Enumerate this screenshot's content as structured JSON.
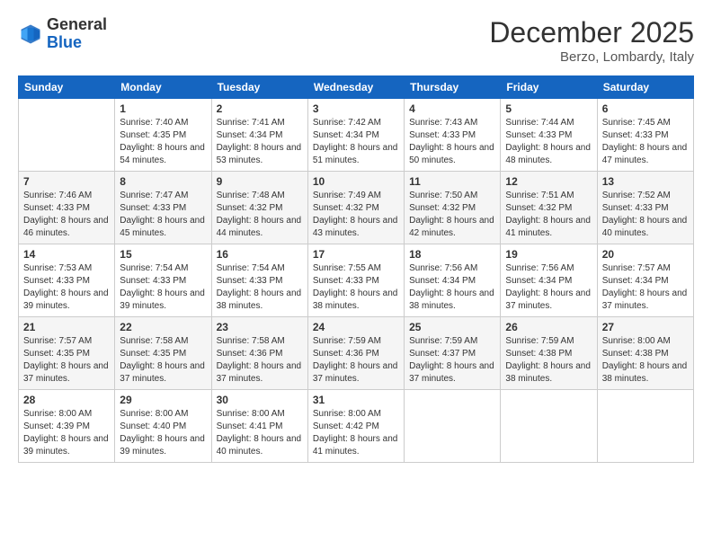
{
  "header": {
    "logo_general": "General",
    "logo_blue": "Blue",
    "month_title": "December 2025",
    "location": "Berzo, Lombardy, Italy"
  },
  "days_of_week": [
    "Sunday",
    "Monday",
    "Tuesday",
    "Wednesday",
    "Thursday",
    "Friday",
    "Saturday"
  ],
  "weeks": [
    [
      {
        "day": "",
        "sunrise": "",
        "sunset": "",
        "daylight": ""
      },
      {
        "day": "1",
        "sunrise": "Sunrise: 7:40 AM",
        "sunset": "Sunset: 4:35 PM",
        "daylight": "Daylight: 8 hours and 54 minutes."
      },
      {
        "day": "2",
        "sunrise": "Sunrise: 7:41 AM",
        "sunset": "Sunset: 4:34 PM",
        "daylight": "Daylight: 8 hours and 53 minutes."
      },
      {
        "day": "3",
        "sunrise": "Sunrise: 7:42 AM",
        "sunset": "Sunset: 4:34 PM",
        "daylight": "Daylight: 8 hours and 51 minutes."
      },
      {
        "day": "4",
        "sunrise": "Sunrise: 7:43 AM",
        "sunset": "Sunset: 4:33 PM",
        "daylight": "Daylight: 8 hours and 50 minutes."
      },
      {
        "day": "5",
        "sunrise": "Sunrise: 7:44 AM",
        "sunset": "Sunset: 4:33 PM",
        "daylight": "Daylight: 8 hours and 48 minutes."
      },
      {
        "day": "6",
        "sunrise": "Sunrise: 7:45 AM",
        "sunset": "Sunset: 4:33 PM",
        "daylight": "Daylight: 8 hours and 47 minutes."
      }
    ],
    [
      {
        "day": "7",
        "sunrise": "Sunrise: 7:46 AM",
        "sunset": "Sunset: 4:33 PM",
        "daylight": "Daylight: 8 hours and 46 minutes."
      },
      {
        "day": "8",
        "sunrise": "Sunrise: 7:47 AM",
        "sunset": "Sunset: 4:33 PM",
        "daylight": "Daylight: 8 hours and 45 minutes."
      },
      {
        "day": "9",
        "sunrise": "Sunrise: 7:48 AM",
        "sunset": "Sunset: 4:32 PM",
        "daylight": "Daylight: 8 hours and 44 minutes."
      },
      {
        "day": "10",
        "sunrise": "Sunrise: 7:49 AM",
        "sunset": "Sunset: 4:32 PM",
        "daylight": "Daylight: 8 hours and 43 minutes."
      },
      {
        "day": "11",
        "sunrise": "Sunrise: 7:50 AM",
        "sunset": "Sunset: 4:32 PM",
        "daylight": "Daylight: 8 hours and 42 minutes."
      },
      {
        "day": "12",
        "sunrise": "Sunrise: 7:51 AM",
        "sunset": "Sunset: 4:32 PM",
        "daylight": "Daylight: 8 hours and 41 minutes."
      },
      {
        "day": "13",
        "sunrise": "Sunrise: 7:52 AM",
        "sunset": "Sunset: 4:33 PM",
        "daylight": "Daylight: 8 hours and 40 minutes."
      }
    ],
    [
      {
        "day": "14",
        "sunrise": "Sunrise: 7:53 AM",
        "sunset": "Sunset: 4:33 PM",
        "daylight": "Daylight: 8 hours and 39 minutes."
      },
      {
        "day": "15",
        "sunrise": "Sunrise: 7:54 AM",
        "sunset": "Sunset: 4:33 PM",
        "daylight": "Daylight: 8 hours and 39 minutes."
      },
      {
        "day": "16",
        "sunrise": "Sunrise: 7:54 AM",
        "sunset": "Sunset: 4:33 PM",
        "daylight": "Daylight: 8 hours and 38 minutes."
      },
      {
        "day": "17",
        "sunrise": "Sunrise: 7:55 AM",
        "sunset": "Sunset: 4:33 PM",
        "daylight": "Daylight: 8 hours and 38 minutes."
      },
      {
        "day": "18",
        "sunrise": "Sunrise: 7:56 AM",
        "sunset": "Sunset: 4:34 PM",
        "daylight": "Daylight: 8 hours and 38 minutes."
      },
      {
        "day": "19",
        "sunrise": "Sunrise: 7:56 AM",
        "sunset": "Sunset: 4:34 PM",
        "daylight": "Daylight: 8 hours and 37 minutes."
      },
      {
        "day": "20",
        "sunrise": "Sunrise: 7:57 AM",
        "sunset": "Sunset: 4:34 PM",
        "daylight": "Daylight: 8 hours and 37 minutes."
      }
    ],
    [
      {
        "day": "21",
        "sunrise": "Sunrise: 7:57 AM",
        "sunset": "Sunset: 4:35 PM",
        "daylight": "Daylight: 8 hours and 37 minutes."
      },
      {
        "day": "22",
        "sunrise": "Sunrise: 7:58 AM",
        "sunset": "Sunset: 4:35 PM",
        "daylight": "Daylight: 8 hours and 37 minutes."
      },
      {
        "day": "23",
        "sunrise": "Sunrise: 7:58 AM",
        "sunset": "Sunset: 4:36 PM",
        "daylight": "Daylight: 8 hours and 37 minutes."
      },
      {
        "day": "24",
        "sunrise": "Sunrise: 7:59 AM",
        "sunset": "Sunset: 4:36 PM",
        "daylight": "Daylight: 8 hours and 37 minutes."
      },
      {
        "day": "25",
        "sunrise": "Sunrise: 7:59 AM",
        "sunset": "Sunset: 4:37 PM",
        "daylight": "Daylight: 8 hours and 37 minutes."
      },
      {
        "day": "26",
        "sunrise": "Sunrise: 7:59 AM",
        "sunset": "Sunset: 4:38 PM",
        "daylight": "Daylight: 8 hours and 38 minutes."
      },
      {
        "day": "27",
        "sunrise": "Sunrise: 8:00 AM",
        "sunset": "Sunset: 4:38 PM",
        "daylight": "Daylight: 8 hours and 38 minutes."
      }
    ],
    [
      {
        "day": "28",
        "sunrise": "Sunrise: 8:00 AM",
        "sunset": "Sunset: 4:39 PM",
        "daylight": "Daylight: 8 hours and 39 minutes."
      },
      {
        "day": "29",
        "sunrise": "Sunrise: 8:00 AM",
        "sunset": "Sunset: 4:40 PM",
        "daylight": "Daylight: 8 hours and 39 minutes."
      },
      {
        "day": "30",
        "sunrise": "Sunrise: 8:00 AM",
        "sunset": "Sunset: 4:41 PM",
        "daylight": "Daylight: 8 hours and 40 minutes."
      },
      {
        "day": "31",
        "sunrise": "Sunrise: 8:00 AM",
        "sunset": "Sunset: 4:42 PM",
        "daylight": "Daylight: 8 hours and 41 minutes."
      },
      {
        "day": "",
        "sunrise": "",
        "sunset": "",
        "daylight": ""
      },
      {
        "day": "",
        "sunrise": "",
        "sunset": "",
        "daylight": ""
      },
      {
        "day": "",
        "sunrise": "",
        "sunset": "",
        "daylight": ""
      }
    ]
  ]
}
